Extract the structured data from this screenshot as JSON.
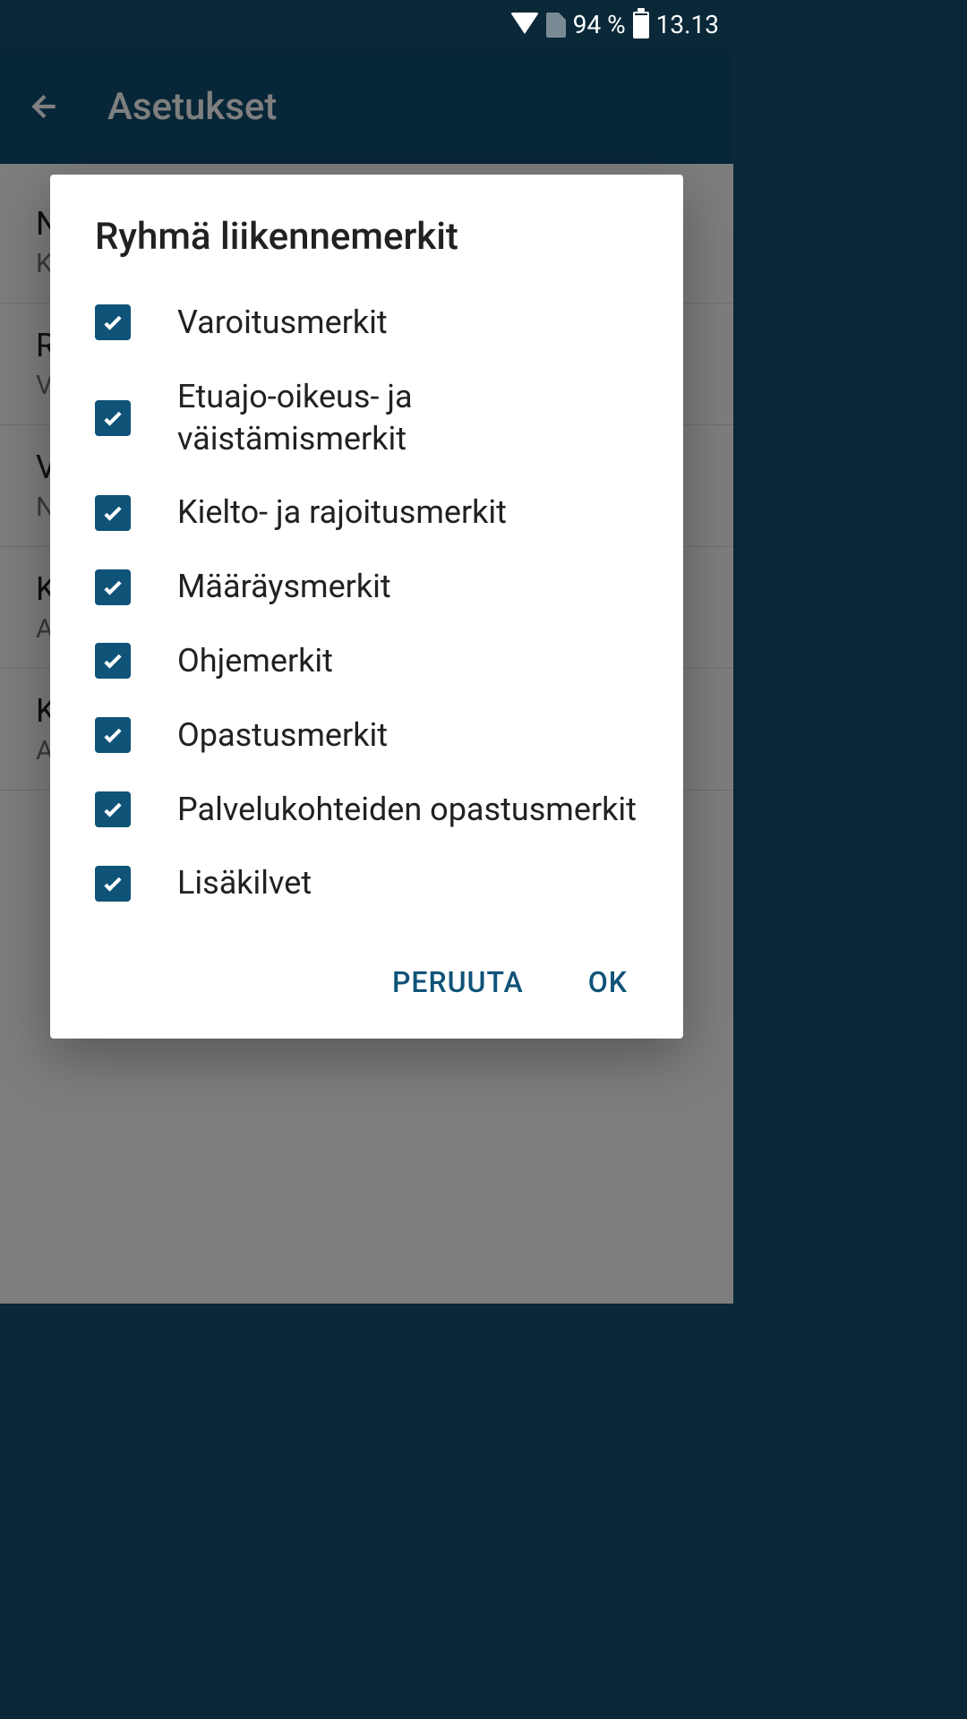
{
  "statusBar": {
    "battery": "94 %",
    "time": "13.13"
  },
  "appBar": {
    "title": "Asetukset"
  },
  "settings": [
    {
      "title": "N",
      "subtitle": "K"
    },
    {
      "title": "R",
      "subtitle": "V"
    },
    {
      "title": "V",
      "subtitle": "N"
    },
    {
      "title": "K",
      "subtitle": "A\nk"
    },
    {
      "title": "K",
      "subtitle": "A\nk"
    }
  ],
  "dialog": {
    "title": "Ryhmä liikennemerkit",
    "options": [
      {
        "label": "Varoitusmerkit",
        "checked": true
      },
      {
        "label": "Etuajo-oikeus- ja väistämismerkit",
        "checked": true
      },
      {
        "label": "Kielto- ja rajoitusmerkit",
        "checked": true
      },
      {
        "label": "Määräysmerkit",
        "checked": true
      },
      {
        "label": "Ohjemerkit",
        "checked": true
      },
      {
        "label": "Opastusmerkit",
        "checked": true
      },
      {
        "label": "Palvelukohteiden opastusmerkit",
        "checked": true
      },
      {
        "label": "Lisäkilvet",
        "checked": true
      }
    ],
    "cancelLabel": "PERUUTA",
    "okLabel": "OK"
  }
}
